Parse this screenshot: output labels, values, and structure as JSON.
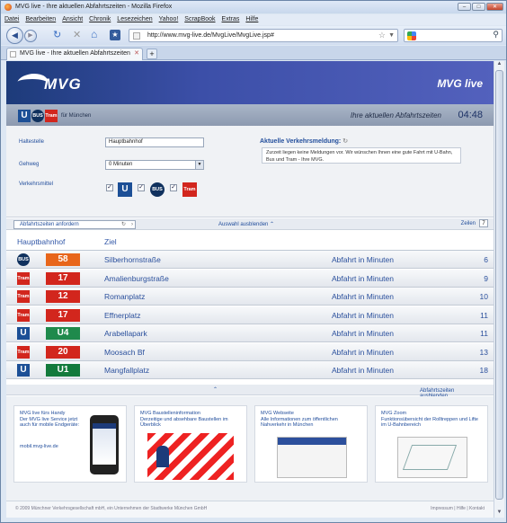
{
  "window": {
    "title": "MVG live - Ihre aktuellen Abfahrtszeiten - Mozilla Firefox"
  },
  "menu": [
    "Datei",
    "Bearbeiten",
    "Ansicht",
    "Chronik",
    "Lesezeichen",
    "Yahoo!",
    "ScrapBook",
    "Extras",
    "Hilfe"
  ],
  "url": "http://www.mvg-live.de/MvgLive/MvgLive.jsp#",
  "tab": {
    "label": "MVG live - Ihre aktuellen Abfahrtszeiten"
  },
  "header": {
    "logo": "MVG",
    "brand": "MVG live",
    "subtitle": "Ihre aktuellen Abfahrtszeiten",
    "time": "04:48",
    "for": "für München",
    "bus": "BUS",
    "tram": "Tram",
    "u": "U"
  },
  "form": {
    "haltestelle_label": "Haltestelle",
    "haltestelle_value": "Hauptbahnhof",
    "gehweg_label": "Gehweg",
    "gehweg_value": "0 Minuten",
    "verkehrsmittel_label": "Verkehrsmittel",
    "notice_title": "Aktuelle Verkehrsmeldung:",
    "notice_text": "Zurzeit liegen keine Meldungen vor. Wir wünschen Ihnen eine gute Fahrt mit U-Bahn, Bus und Tram - Ihre MVG."
  },
  "toolbar": {
    "request_label": "Abfahrtszeiten anfordern",
    "hide_selection": "Auswahl ausblenden",
    "zeilen_label": "Zeilen",
    "zeilen_value": "7",
    "hide_times": "Abfahrtszeiten ausblenden"
  },
  "table": {
    "station": "Hauptbahnhof",
    "col_ziel": "Ziel",
    "rows": [
      {
        "type": "BUS",
        "line": "58",
        "ziel": "Silberhornstraße",
        "label": "Abfahrt in Minuten",
        "min": "6",
        "color": "#e8661b"
      },
      {
        "type": "Tram",
        "line": "17",
        "ziel": "Amalienburgstraße",
        "label": "Abfahrt in Minuten",
        "min": "9",
        "color": "#d2261d"
      },
      {
        "type": "Tram",
        "line": "12",
        "ziel": "Romanplatz",
        "label": "Abfahrt in Minuten",
        "min": "10",
        "color": "#d2261d"
      },
      {
        "type": "Tram",
        "line": "17",
        "ziel": "Effnerplatz",
        "label": "Abfahrt in Minuten",
        "min": "11",
        "color": "#d2261d"
      },
      {
        "type": "U",
        "line": "U4",
        "ziel": "Arabellapark",
        "label": "Abfahrt in Minuten",
        "min": "11",
        "color": "#1f8a4c"
      },
      {
        "type": "Tram",
        "line": "20",
        "ziel": "Moosach Bf",
        "label": "Abfahrt in Minuten",
        "min": "13",
        "color": "#d2261d"
      },
      {
        "type": "U",
        "line": "U1",
        "ziel": "Mangfallplatz",
        "label": "Abfahrt in Minuten",
        "min": "18",
        "color": "#137a3c"
      }
    ]
  },
  "cards": [
    {
      "title": "MVG live fürs Handy\nDer MVG live Service jetzt auch für mobile Endgeräte:",
      "link": "mobil.mvg-live.de"
    },
    {
      "title": "MVG Baustelleninformation\nDerzeitige und absehbare Baustellen im Überblick"
    },
    {
      "title": "MVG Webseite\nAlle Informationen zum öffentlichen Nahverkehr in München"
    },
    {
      "title": "MVG Zoom\nFunktionsübersicht der Rolltreppen und Lifte im U-Bahnbereich"
    }
  ],
  "footer": {
    "copyright": "© 2009 Münchner Verkehrsgesellschaft mbH, ein Unternehmen der Stadtwerke München GmbH",
    "links": "Impressum | Hilfe | Kontakt"
  }
}
